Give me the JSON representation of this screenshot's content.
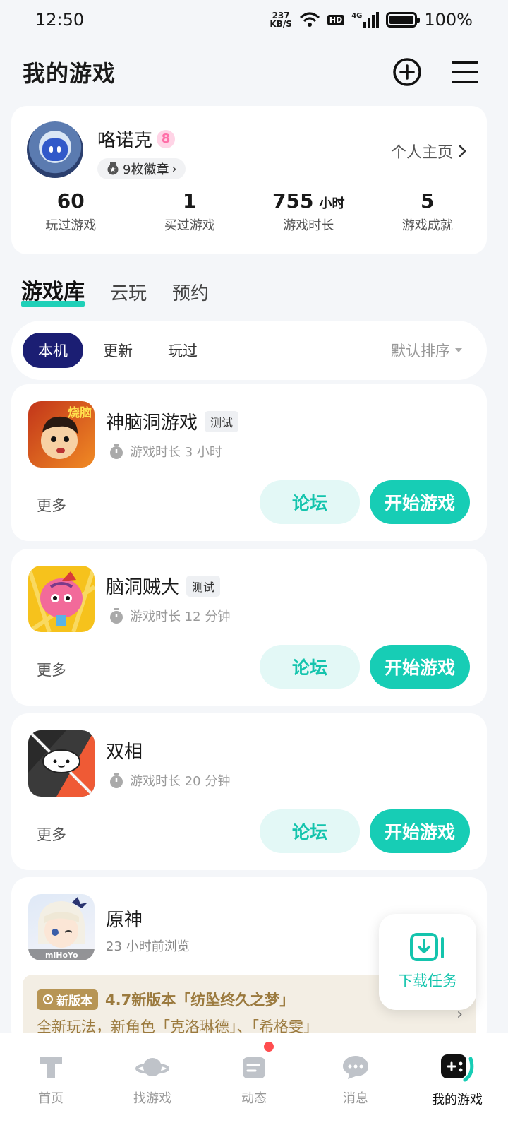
{
  "status_bar": {
    "time": "12:50",
    "net_speed_value": "237",
    "net_speed_unit": "KB/S",
    "hd": "HD",
    "network": "4G",
    "battery": "100%"
  },
  "header": {
    "title": "我的游戏"
  },
  "profile": {
    "name": "咯诺克",
    "level": "8",
    "badges": "9枚徽章",
    "homepage": "个人主页",
    "stats": [
      {
        "value": "60",
        "unit": "",
        "label": "玩过游戏"
      },
      {
        "value": "1",
        "unit": "",
        "label": "买过游戏"
      },
      {
        "value": "755",
        "unit": "小时",
        "label": "游戏时长"
      },
      {
        "value": "5",
        "unit": "",
        "label": "游戏成就"
      }
    ]
  },
  "library_tabs": [
    "游戏库",
    "云玩",
    "预约"
  ],
  "filters": {
    "chips": [
      "本机",
      "更新",
      "玩过"
    ],
    "sort": "默认排序"
  },
  "games": [
    {
      "name": "神脑洞游戏",
      "tag": "测试",
      "meta": "游戏时长 3 小时",
      "more": "更多",
      "forum": "论坛",
      "play": "开始游戏",
      "icon_text": "烧脑"
    },
    {
      "name": "脑洞贼大",
      "tag": "测试",
      "meta": "游戏时长 12 分钟",
      "more": "更多",
      "forum": "论坛",
      "play": "开始游戏"
    },
    {
      "name": "双相",
      "tag": "",
      "meta": "游戏时长 20 分钟",
      "more": "更多",
      "forum": "论坛",
      "play": "开始游戏"
    }
  ],
  "genshin": {
    "name": "原神",
    "meta": "23 小时前浏览",
    "icon_text": "miHoYo",
    "news_badge": "新版本",
    "news_title": "4.7新版本「纺坠终久之梦」",
    "news_desc": "全新玩法，新角色「克洛琳德」、「希格雯」"
  },
  "fab": {
    "label": "下载任务"
  },
  "bottom_nav": [
    "首页",
    "找游戏",
    "动态",
    "消息",
    "我的游戏"
  ],
  "colors": {
    "accent": "#17cdb5",
    "chip_active": "#1b1e73",
    "news": "#9b7a3e"
  }
}
